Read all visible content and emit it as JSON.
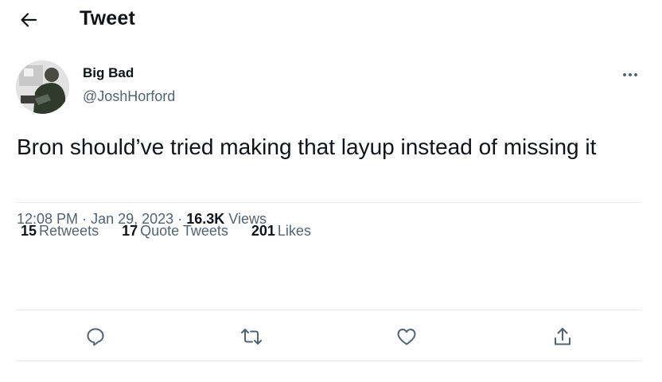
{
  "header": {
    "back_icon": "arrow-left-icon",
    "title": "Tweet"
  },
  "tweet": {
    "author": {
      "display_name": "Big Bad",
      "handle": "@JoshHorford",
      "avatar": "profile-photo"
    },
    "more_icon": "ellipsis-icon",
    "text": "Bron should’ve tried making that layup instead of missing it",
    "time": "12:08 PM",
    "separator": "·",
    "date": "Jan 29, 2023",
    "views_count": "16.3K",
    "views_label": "Views"
  },
  "stats": {
    "retweets_count": "15",
    "retweets_label": "Retweets",
    "quotes_count": "17",
    "quotes_label": "Quote Tweets",
    "likes_count": "201",
    "likes_label": "Likes"
  },
  "actions": [
    {
      "name": "reply",
      "icon": "reply-icon"
    },
    {
      "name": "retweet",
      "icon": "retweet-icon"
    },
    {
      "name": "like",
      "icon": "heart-icon"
    },
    {
      "name": "share",
      "icon": "share-icon"
    }
  ],
  "colors": {
    "text_primary": "#0f1419",
    "text_secondary": "#536471",
    "divider": "#e7e9ea",
    "background": "#ffffff"
  }
}
